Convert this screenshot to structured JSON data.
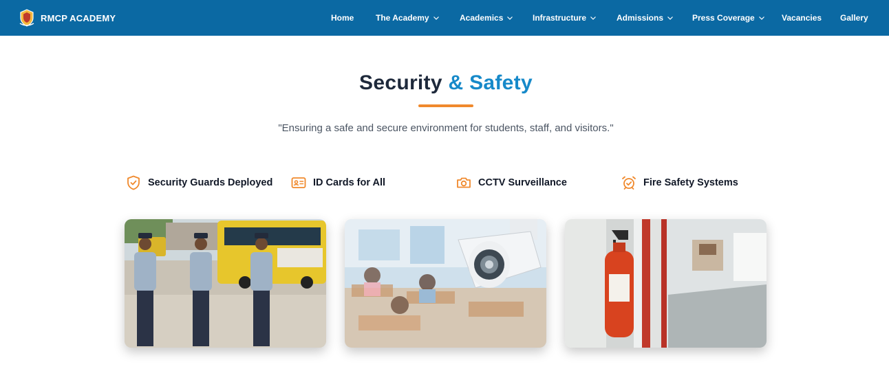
{
  "nav": {
    "brand": "RMCP ACADEMY",
    "items": [
      {
        "label": "Home"
      },
      {
        "label": "The Academy"
      },
      {
        "label": "Academics"
      },
      {
        "label": "Infrastructure"
      },
      {
        "label": "Admissions"
      },
      {
        "label": "Press Coverage"
      },
      {
        "label": "Vacancies"
      },
      {
        "label": "Gallery"
      }
    ]
  },
  "hero": {
    "title_part1": "Security",
    "title_part2": "& Safety",
    "subtitle": "\"Ensuring a safe and secure environment for students, staff, and visitors.\""
  },
  "features": [
    {
      "label": "Security Guards Deployed",
      "icon": "shield-check-icon"
    },
    {
      "label": "ID Cards for All",
      "icon": "id-card-icon"
    },
    {
      "label": "CCTV Surveillance",
      "icon": "camera-icon"
    },
    {
      "label": "Fire Safety Systems",
      "icon": "alarm-clock-icon"
    }
  ],
  "cards": [
    {
      "image": "security-guards-saluting-photo"
    },
    {
      "image": "cctv-camera-classroom-photo"
    },
    {
      "image": "fire-extinguisher-hallway-photo"
    }
  ],
  "colors": {
    "navbar": "#0b69a3",
    "accent_blue": "#1689c9",
    "accent_orange": "#f0892c",
    "heading": "#1e293b"
  }
}
